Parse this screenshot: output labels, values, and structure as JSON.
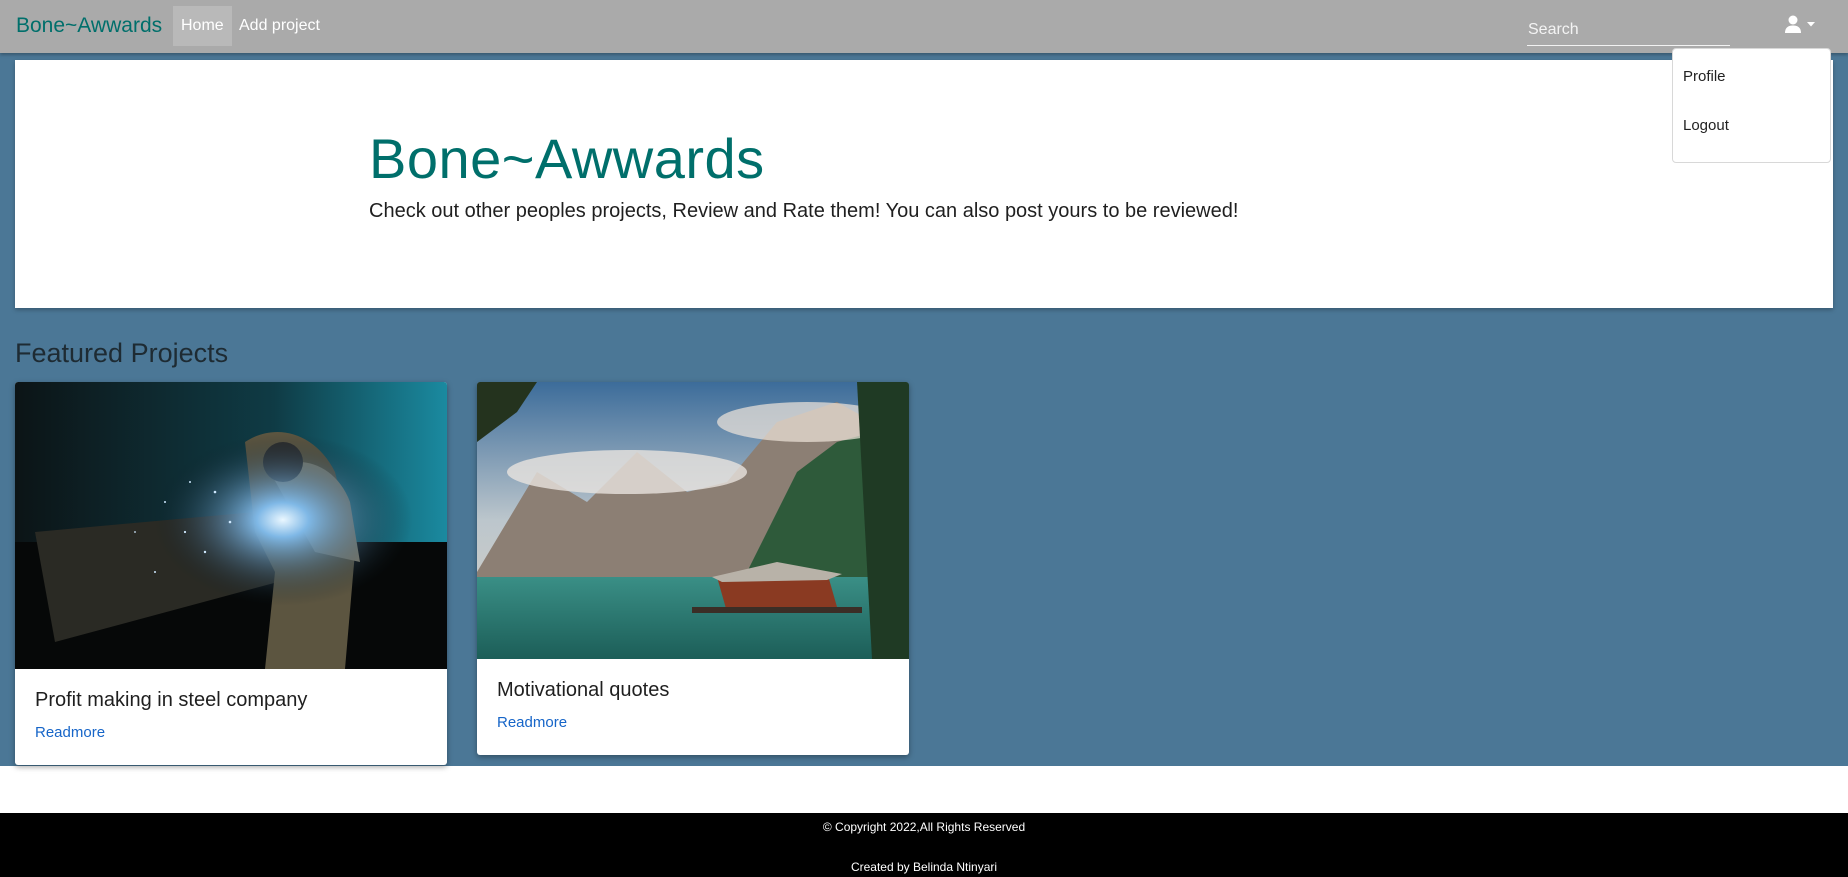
{
  "navbar": {
    "brand": "Bone~Awwards",
    "links": [
      {
        "label": "Home"
      },
      {
        "label": "Add project"
      }
    ],
    "search_placeholder": "Search",
    "user_icon": "user-icon"
  },
  "user_menu": {
    "items": [
      {
        "label": "Profile"
      },
      {
        "label": "Logout"
      }
    ]
  },
  "hero": {
    "title": "Bone~Awwards",
    "subtitle": "Check out other peoples projects, Review and Rate them! You can also post yours to be reviewed!"
  },
  "featured": {
    "heading": "Featured Projects",
    "projects": [
      {
        "title": "Profit making in steel company",
        "link_label": "Readmore",
        "image": "welder-photo"
      },
      {
        "title": "Motivational quotes",
        "link_label": "Readmore",
        "image": "mountain-lake-photo"
      }
    ]
  },
  "footer": {
    "copyright": "© Copyright 2022,All Rights Reserved",
    "credit": "Created by Belinda Ntinyari"
  },
  "colors": {
    "navbar": "#aaaaaa",
    "brand": "#006f6b",
    "page_background": "#4b7796",
    "link": "#1665c8",
    "footer": "#000000"
  }
}
